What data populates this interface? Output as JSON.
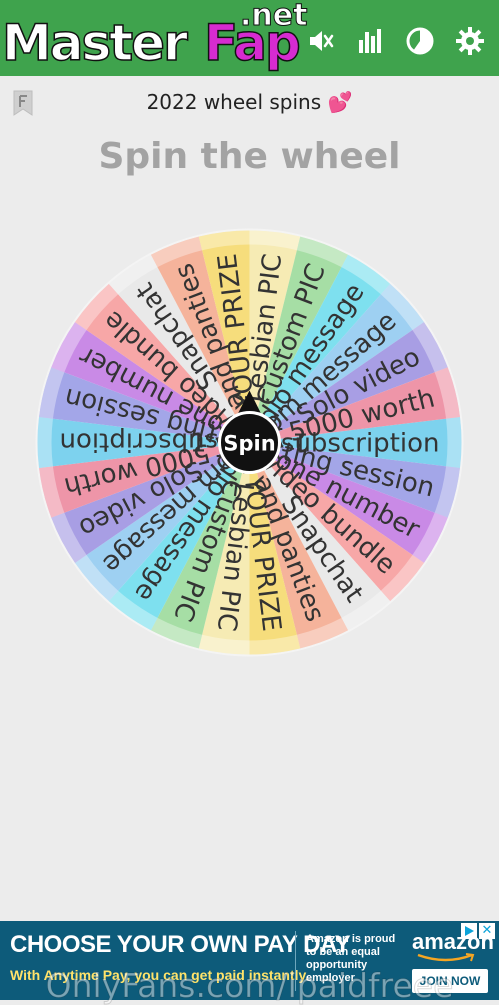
{
  "watermark": {
    "brand_part1": "Master",
    "brand_part2": "Fap",
    "brand_suffix": ".net"
  },
  "toolbar": {
    "icons": [
      "mute-icon",
      "stats-icon",
      "pie-icon",
      "settings-icon"
    ]
  },
  "wheel_title": "2022 wheel spins",
  "wheel_title_emoji": "💕",
  "page_heading": "Spin the wheel",
  "wheel": {
    "center_button": "Spin",
    "segments": [
      {
        "label": "1 year subscription",
        "color": "#7dd2ee"
      },
      {
        "label": "Sexting session",
        "color": "#a3a6e8"
      },
      {
        "label": "Phone number",
        "color": "#c98ae6"
      },
      {
        "label": "3 video bundle",
        "color": "#f7a7a7"
      },
      {
        "label": "Snapchat",
        "color": "#e9e9e9"
      },
      {
        "label": "Bra and panties",
        "color": "#f5b39b"
      },
      {
        "label": "PICK YOUR PRIZE",
        "color": "#f6dd7c"
      },
      {
        "label": "Lesbian PIC",
        "color": "#f6ebb4"
      },
      {
        "label": "Custom PIC",
        "color": "#a6dea5"
      },
      {
        "label": "Audio message",
        "color": "#7ee0ef"
      },
      {
        "label": "Custom message",
        "color": "#9ed0f2"
      },
      {
        "label": "Solo video",
        "color": "#a89ee4"
      },
      {
        "label": "5000 worth",
        "color": "#ee95a8"
      }
    ]
  },
  "ad": {
    "headline": "CHOOSE YOUR OWN PAY DAY",
    "subline": "With Anytime Pay, you can get paid instantly.",
    "promo": "Amazon is proud to be an equal opportunity employer",
    "brand": "amazon",
    "cta": "JOIN NOW",
    "close": "✕"
  },
  "footer_watermark": "OnlyFans.com/ipaidfreee"
}
